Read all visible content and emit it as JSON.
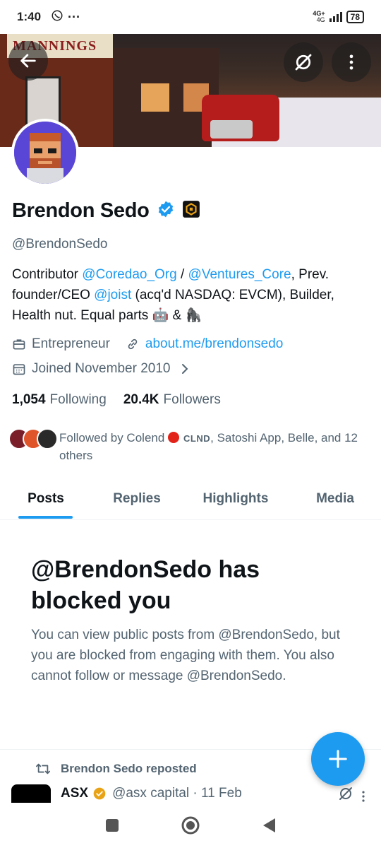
{
  "status_bar": {
    "time": "1:40",
    "network": "4G+",
    "network_sub": "4G",
    "battery": "78"
  },
  "profile": {
    "name": "Brendon Sedo",
    "handle": "@BrendonSedo",
    "bio": {
      "part1": "Contributor ",
      "link1": "@Coredao_Org",
      "part2": " / ",
      "link2": "@Ventures_Core",
      "part3": ", Prev. founder/CEO ",
      "link3": "@joist",
      "part4": " (acq'd NASDAQ: EVCM), Builder, Health nut. Equal parts ",
      "emoji1": "🤖",
      "part5": " & ",
      "emoji2": "🦍"
    },
    "category": "Entrepreneur",
    "website": "about.me/brendonsedo",
    "joined": "Joined November 2010",
    "following_count": "1,054",
    "following_label": "Following",
    "followers_count": "20.4K",
    "followers_label": "Followers",
    "followed_by": {
      "prefix": "Followed by Colend ",
      "ticker": "CLND",
      "rest": ", Satoshi App, Belle, and 12 others"
    }
  },
  "tabs": [
    {
      "label": "Posts",
      "active": true
    },
    {
      "label": "Replies",
      "active": false
    },
    {
      "label": "Highlights",
      "active": false
    },
    {
      "label": "Media",
      "active": false
    }
  ],
  "blocked": {
    "title": "@BrendonSedo has blocked you",
    "body": "You can view public posts from @BrendonSedo, but you are blocked from engaging with them. You also cannot follow or message @BrendonSedo."
  },
  "feed": {
    "repost_label": "Brendon Sedo reposted",
    "tweet_name": "ASX",
    "tweet_meta": "@asx capital · 11 Feb"
  },
  "colors": {
    "accent": "#1d9bf0",
    "text": "#0f1419",
    "muted": "#536471",
    "verified": "#1d9bf0",
    "gold_badge": "#e8a317"
  }
}
